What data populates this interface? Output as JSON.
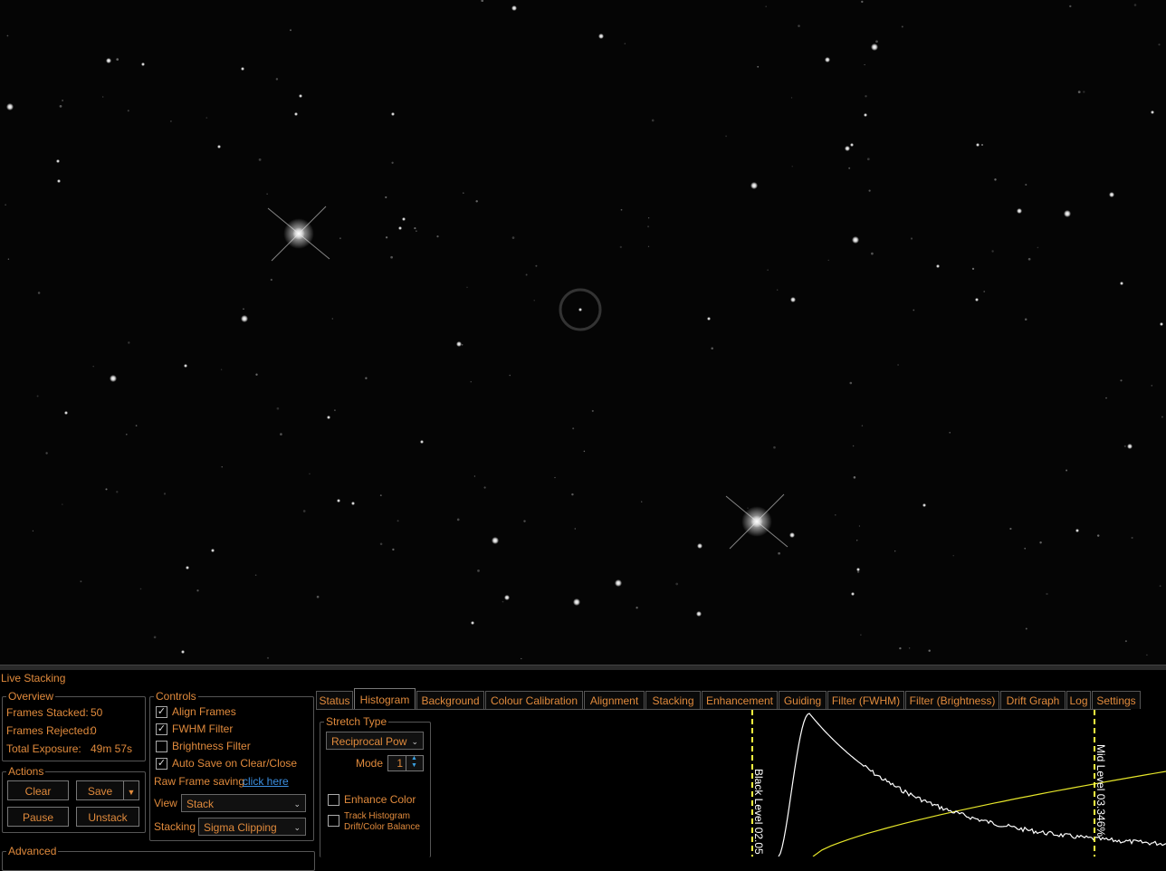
{
  "panel_title": "Live Stacking",
  "overview": {
    "legend": "Overview",
    "frames_stacked_label": "Frames Stacked:",
    "frames_stacked_value": "50",
    "frames_rejected_label": "Frames Rejected:",
    "frames_rejected_value": "0",
    "total_exposure_label": "Total Exposure:",
    "total_exposure_value": "49m 57s"
  },
  "actions": {
    "legend": "Actions",
    "clear": "Clear",
    "save": "Save",
    "pause": "Pause",
    "unstack": "Unstack"
  },
  "advanced": {
    "legend": "Advanced"
  },
  "controls": {
    "legend": "Controls",
    "align_frames": "Align Frames",
    "align_frames_checked": true,
    "fwhm_filter": "FWHM Filter",
    "fwhm_filter_checked": true,
    "brightness_filter": "Brightness Filter",
    "brightness_filter_checked": false,
    "auto_save": "Auto Save on Clear/Close",
    "auto_save_checked": true,
    "raw_frame_label": "Raw Frame saving",
    "raw_frame_link": "click here",
    "view_label": "View",
    "view_value": "Stack",
    "stacking_label": "Stacking",
    "stacking_value": "Sigma Clipping"
  },
  "tabs": [
    "Status",
    "Histogram",
    "Background",
    "Colour Calibration",
    "Alignment",
    "Stacking",
    "Enhancement",
    "Guiding",
    "Filter (FWHM)",
    "Filter (Brightness)",
    "Drift Graph",
    "Log",
    "Settings"
  ],
  "active_tab": "Histogram",
  "stretch": {
    "legend": "Stretch Type",
    "type_value": "Reciprocal Pow",
    "mode_label": "Mode",
    "mode_value": "1",
    "enhance_color": "Enhance Color",
    "enhance_color_checked": false,
    "track_histogram_line1": "Track Histogram",
    "track_histogram_line2": "Drift/Color Balance",
    "track_histogram_checked": false
  },
  "histogram": {
    "black_level_label": "Black Level",
    "black_level_value": "02.05",
    "mid_level_label": "Mid Level",
    "mid_level_value": "03.346%",
    "curve_color": "#ffffff",
    "stretch_curve_color": "#e6e62a",
    "marker_color": "#ffff40"
  },
  "colors": {
    "accent": "#e08a3c",
    "link": "#3a8ee0"
  }
}
